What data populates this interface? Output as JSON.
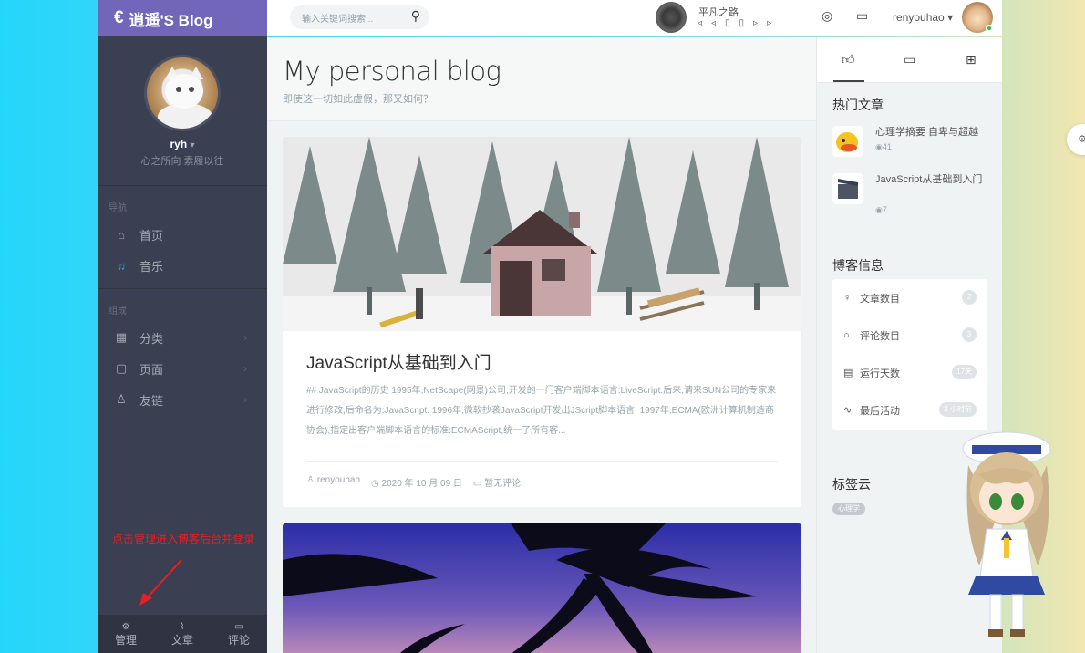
{
  "brand": {
    "symbol": "€",
    "name": "逍遥'S Blog"
  },
  "profile": {
    "name": "ryh",
    "motto": "心之所向 素履以往"
  },
  "nav": {
    "header": "导航",
    "items": [
      {
        "label": "首页",
        "icon": "home-icon"
      },
      {
        "label": "音乐",
        "icon": "music-icon",
        "active": true
      }
    ]
  },
  "compose": {
    "header": "组成",
    "items": [
      {
        "label": "分类",
        "icon": "grid-icon"
      },
      {
        "label": "页面",
        "icon": "page-icon"
      },
      {
        "label": "友链",
        "icon": "user-icon"
      }
    ]
  },
  "hint": "点击管理进入博客后台并登录",
  "footer": {
    "admin": "管理",
    "posts": "文章",
    "comments": "评论"
  },
  "header": {
    "search_placeholder": "输入关键词搜索...",
    "song": "平凡之路",
    "username": "renyouhao"
  },
  "page": {
    "title": "My personal blog",
    "subtitle": "即使这一切如此虚假，那又如何？"
  },
  "post": {
    "title": "JavaScript从基础到入门",
    "excerpt": "## JavaScript的历史 1995年,NetScape(网景)公司,开发的一门客户端脚本语言:LiveScript.后来,请来SUN公司的专家来进行修改,后命名为:JavaScript. 1996年,微软抄袭JavaScript开发出JScript脚本语言. 1997年,ECMA(欧洲计算机制造商协会),指定出客户端脚本语言的标准:ECMAScript,统一了所有客...",
    "author": "renyouhao",
    "date": "2020 年 10 月 09 日",
    "comments": "暂无评论"
  },
  "aside": {
    "hot_title": "热门文章",
    "hot": [
      {
        "title": "心理学摘要 自卑与超越",
        "views": "41"
      },
      {
        "title": "JavaScript从基础到入门",
        "views": "7"
      }
    ],
    "info_title": "博客信息",
    "info": [
      {
        "label": "文章数目",
        "value": "2"
      },
      {
        "label": "评论数目",
        "value": "3"
      },
      {
        "label": "运行天数",
        "value": "17天"
      },
      {
        "label": "最后活动",
        "value": "2 小时前"
      }
    ],
    "tags_title": "标签云",
    "tags": [
      "心理学"
    ]
  },
  "colors": {
    "brand": "#7266ba",
    "sidebar": "#3a3f51",
    "accent": "#23b7e5",
    "hint": "#e81e22"
  }
}
